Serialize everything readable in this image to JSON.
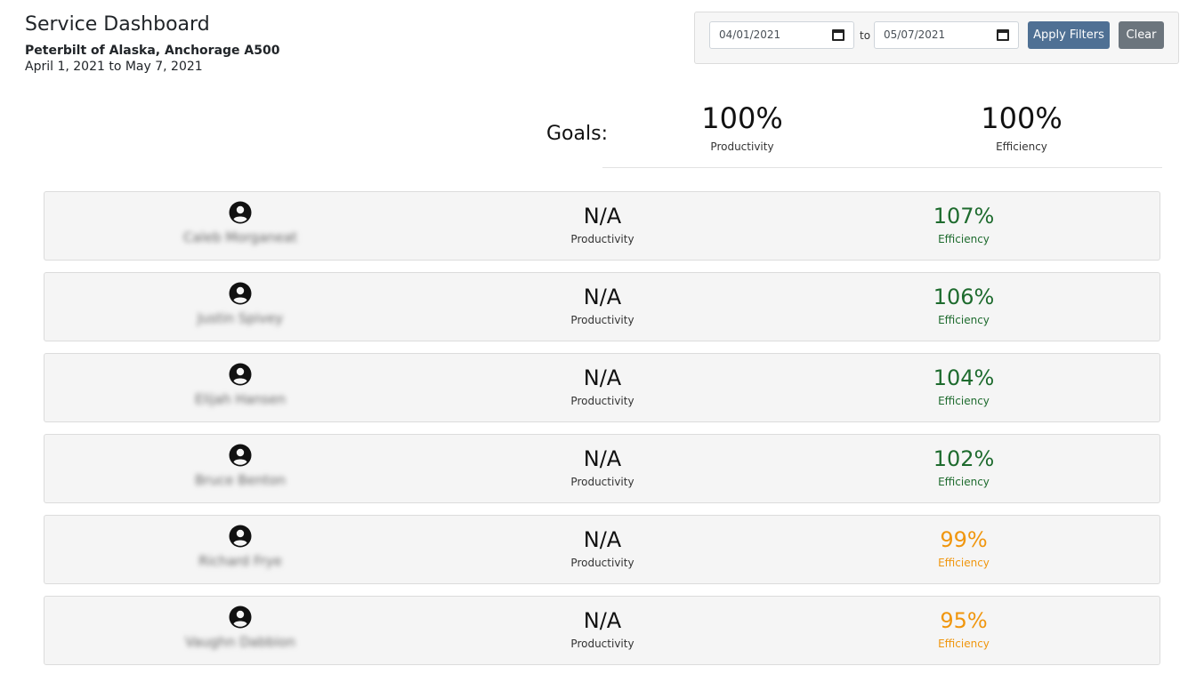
{
  "header": {
    "title": "Service Dashboard",
    "dealer": "Peterbilt of Alaska, Anchorage A500",
    "range": "April 1, 2021 to May 7, 2021"
  },
  "filters": {
    "from_date": "04/01/2021",
    "to_label": "to",
    "to_date": "05/07/2021",
    "apply_label": "Apply Filters",
    "clear_label": "Clear"
  },
  "goals": {
    "label": "Goals:",
    "productivity": {
      "value": "100%",
      "label": "Productivity"
    },
    "efficiency": {
      "value": "100%",
      "label": "Efficiency"
    }
  },
  "technicians": [
    {
      "name": "Caleb Morganeat",
      "productivity": "N/A",
      "productivity_label": "Productivity",
      "efficiency": "107%",
      "efficiency_label": "Efficiency",
      "status": "green"
    },
    {
      "name": "Justin Spivey",
      "productivity": "N/A",
      "productivity_label": "Productivity",
      "efficiency": "106%",
      "efficiency_label": "Efficiency",
      "status": "green"
    },
    {
      "name": "Elijah Hansen",
      "productivity": "N/A",
      "productivity_label": "Productivity",
      "efficiency": "104%",
      "efficiency_label": "Efficiency",
      "status": "green"
    },
    {
      "name": "Bruce Benton",
      "productivity": "N/A",
      "productivity_label": "Productivity",
      "efficiency": "102%",
      "efficiency_label": "Efficiency",
      "status": "green"
    },
    {
      "name": "Richard Frye",
      "productivity": "N/A",
      "productivity_label": "Productivity",
      "efficiency": "99%",
      "efficiency_label": "Efficiency",
      "status": "orange"
    },
    {
      "name": "Vaughn Dabbion",
      "productivity": "N/A",
      "productivity_label": "Productivity",
      "efficiency": "95%",
      "efficiency_label": "Efficiency",
      "status": "orange"
    }
  ],
  "colors": {
    "green": "#1e6b2e",
    "orange": "#f0960e",
    "apply_button": "#4f7094",
    "clear_button": "#6c757d"
  },
  "icons": {
    "avatar": "user-circle-icon",
    "calendar": "calendar-icon"
  }
}
